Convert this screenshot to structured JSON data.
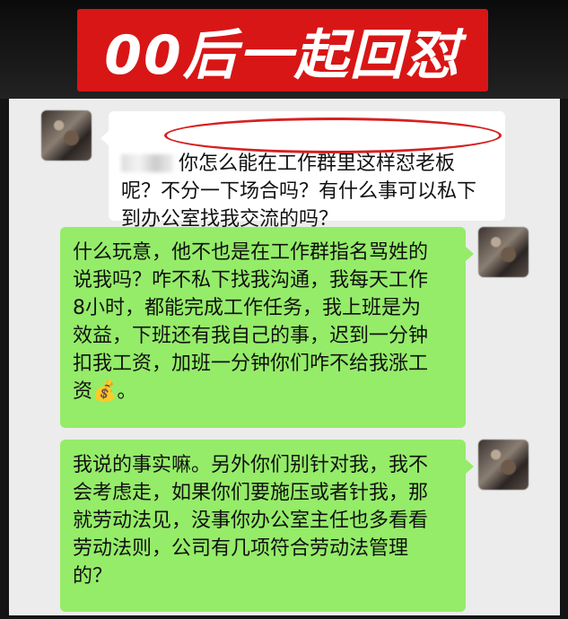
{
  "banner": {
    "title": "00后一起回怼"
  },
  "messages": [
    {
      "side": "left",
      "text": "你怎么能在工作群里这样怼老板\n呢？不分一下场合吗？有什么事可以私下\n到办公室找我交流的吗？"
    },
    {
      "side": "right",
      "text": "什么玩意，他不也是在工作群指名骂姓的\n说我吗？咋不私下找我沟通，我每天工作\n8小时，都能完成工作任务，我上班是为\n效益，下班还有我自己的事，迟到一分钟\n扣我工资，加班一分钟你们咋不给我涨工\n资💰。"
    },
    {
      "side": "right",
      "text": "我说的事实嘛。另外你们别针对我，我不\n会考虑走，如果你们要施压或者针我，那\n就劳动法见，没事你办公室主任也多看看\n劳动法则，公司有几项符合劳动法管理\n的？"
    }
  ],
  "colors": {
    "banner": "#d81616",
    "sent_bubble": "#95ec69",
    "received_bubble": "#ffffff",
    "highlight_oval": "#d62020"
  }
}
